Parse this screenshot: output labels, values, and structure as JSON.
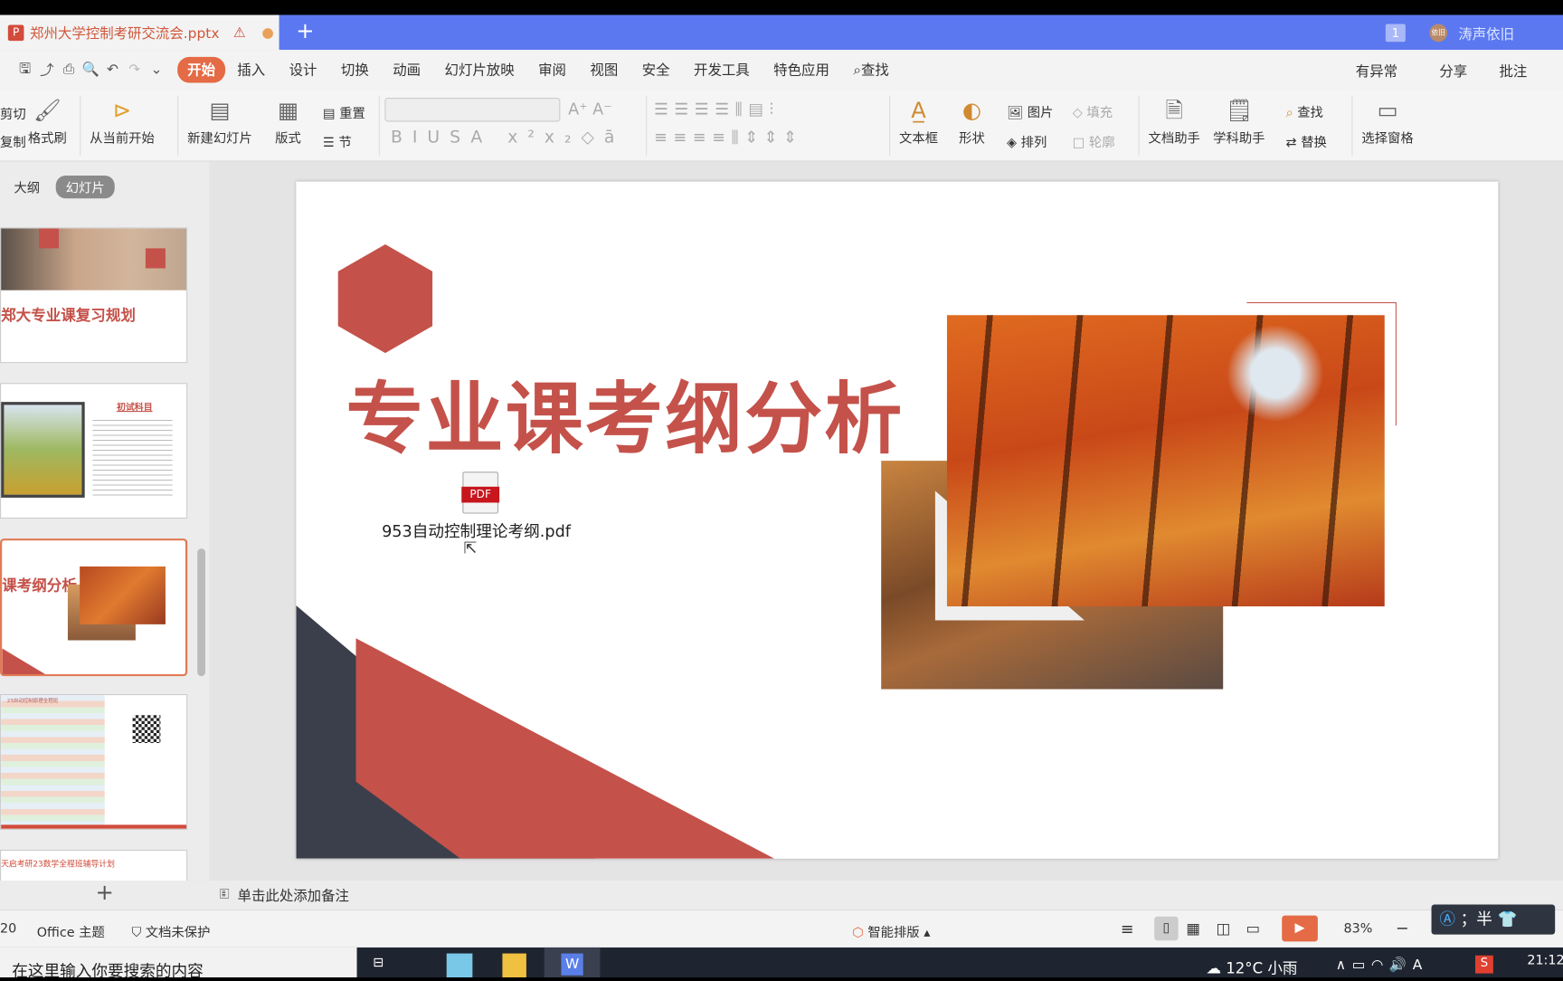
{
  "window": {
    "doc_tab": "郑州大学控制考研交流会.pptx",
    "warning_icon": "warning-icon",
    "new_tab": "+",
    "page_badge": "1",
    "user_name": "涛声依旧",
    "avatar_text": "依旧"
  },
  "menu": {
    "items": [
      "开始",
      "插入",
      "设计",
      "切换",
      "动画",
      "幻灯片放映",
      "审阅",
      "视图",
      "安全",
      "开发工具",
      "特色应用"
    ],
    "search": "查找",
    "right": [
      "有异常",
      "分享",
      "批注"
    ]
  },
  "ribbon": {
    "cut": "剪切",
    "copy": "复制",
    "format_painter": "格式刷",
    "from_current": "从当前开始",
    "new_slide": "新建幻灯片",
    "layout": "版式",
    "reset": "重置",
    "section": "节",
    "textbox": "文本框",
    "shape": "形状",
    "picture": "图片",
    "fill": "填充",
    "arrange": "排列",
    "outline": "轮廓",
    "doc_assistant": "文档助手",
    "subject_assistant": "学科助手",
    "find": "查找",
    "replace": "替换",
    "selection_pane": "选择窗格"
  },
  "panel": {
    "tab_outline": "大纲",
    "tab_slides": "幻灯片",
    "add": "+",
    "thumbs": [
      {
        "title": "郑大专业课复习规划"
      },
      {
        "title": "初试科目"
      },
      {
        "title": "课考纲分析"
      },
      {
        "title": "23自动控制原理全程班"
      },
      {
        "title": "天启考研23数学全程班辅导计划"
      }
    ]
  },
  "slide": {
    "title": "专业课考纲分析",
    "pdf_badge": "PDF",
    "pdf_name": "953自动控制理论考纲.pdf",
    "colors": {
      "accent": "#c4524a",
      "dark": "#3a3f4b"
    }
  },
  "notes": {
    "placeholder": "单击此处添加备注"
  },
  "status": {
    "slide_num": "20",
    "theme": "Office 主题",
    "protect": "文档未保护",
    "smart": "智能排版",
    "zoom": "83%",
    "ime": "；半"
  },
  "taskbar": {
    "search": "在这里输入你要搜索的内容",
    "weather": "12°C 小雨",
    "time": "21:12"
  }
}
